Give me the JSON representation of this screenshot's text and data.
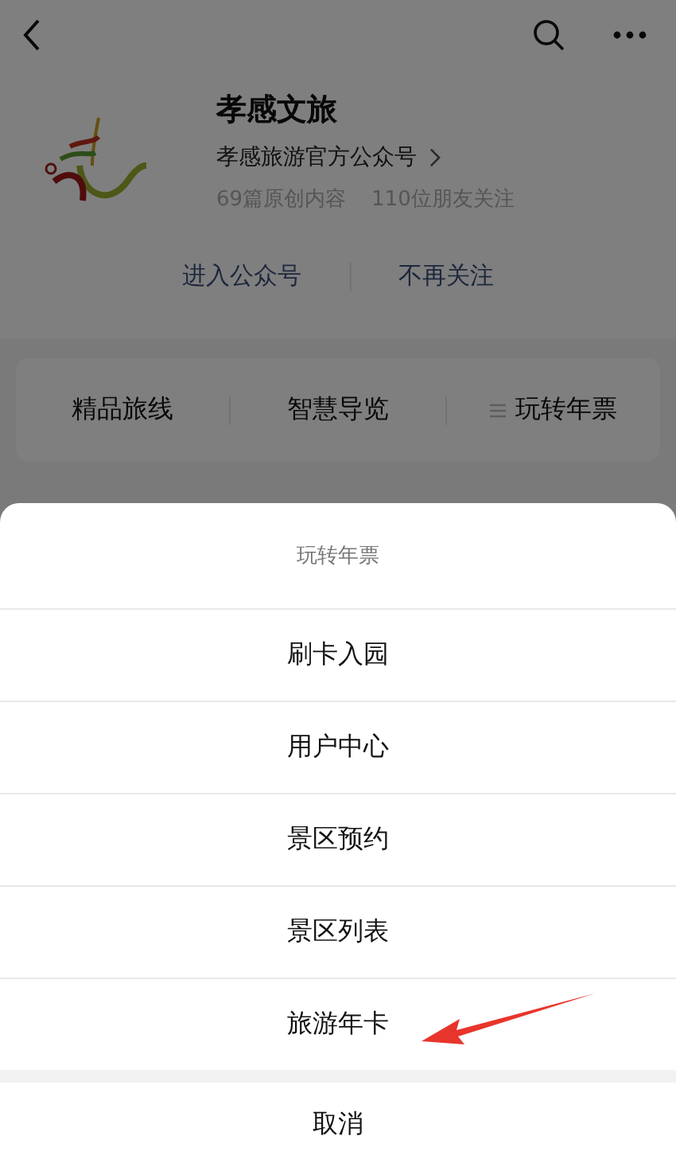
{
  "account": {
    "name": "孝感文旅",
    "description": "孝感旅游官方公众号",
    "stats": [
      "69篇原创内容",
      "110位朋友关注"
    ]
  },
  "actions": [
    "进入公众号",
    "不再关注"
  ],
  "menu": [
    {
      "label": "精品旅线",
      "has_submenu": false
    },
    {
      "label": "智慧导览",
      "has_submenu": false
    },
    {
      "label": "玩转年票",
      "has_submenu": true
    }
  ],
  "sheet": {
    "title": "玩转年票",
    "items": [
      {
        "label": "刷卡入园",
        "annotated": false
      },
      {
        "label": "用户中心",
        "annotated": false
      },
      {
        "label": "景区预约",
        "annotated": false
      },
      {
        "label": "景区列表",
        "annotated": false
      },
      {
        "label": "旅游年卡",
        "annotated": true
      }
    ],
    "cancel": "取消"
  }
}
